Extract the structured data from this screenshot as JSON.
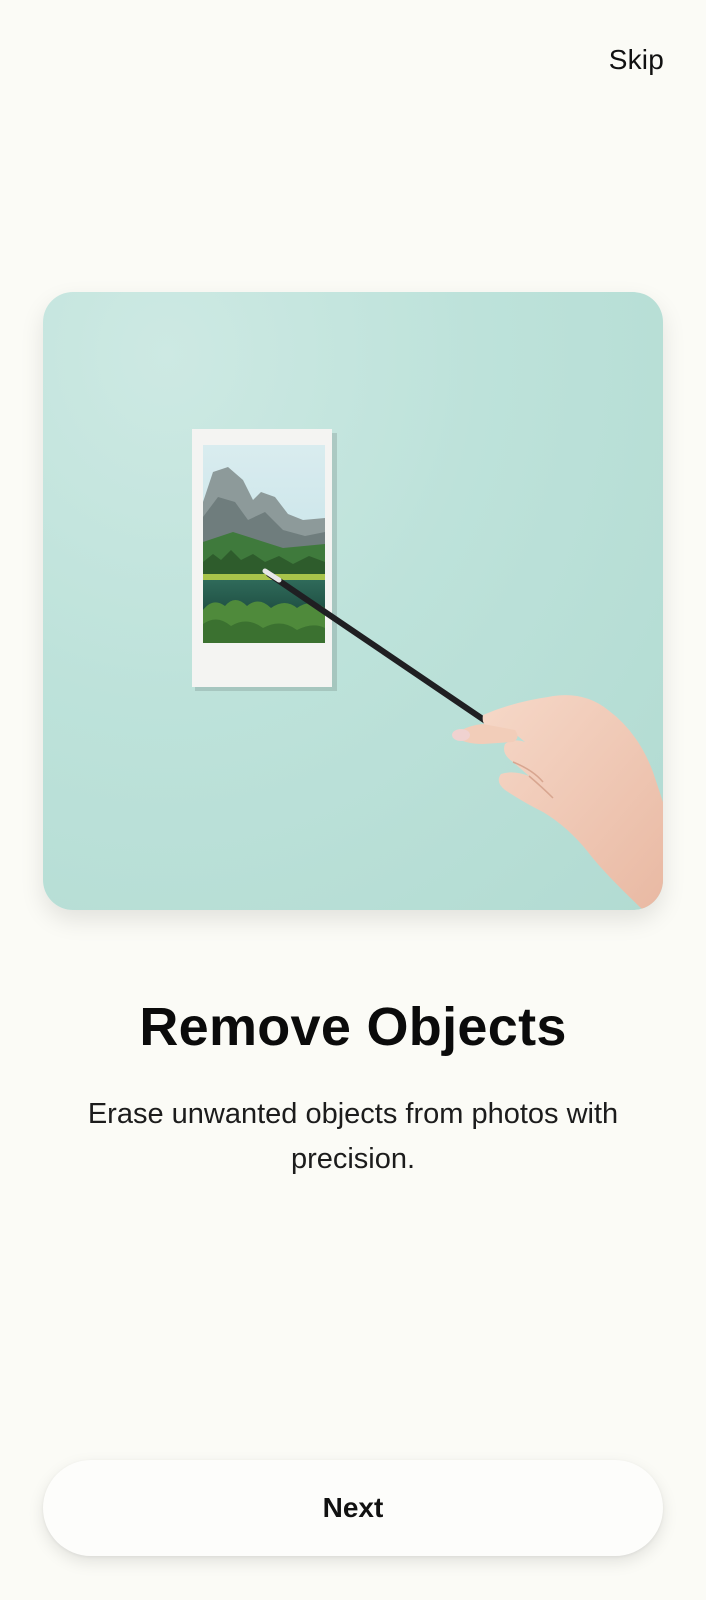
{
  "header": {
    "skip_label": "Skip"
  },
  "hero": {
    "illustration": "hand-with-wand-pointing-at-mountain-lake-photo",
    "background_color": "#bde2da"
  },
  "onboarding": {
    "title": "Remove Objects",
    "description": "Erase unwanted objects from photos with precision."
  },
  "footer": {
    "next_label": "Next"
  }
}
